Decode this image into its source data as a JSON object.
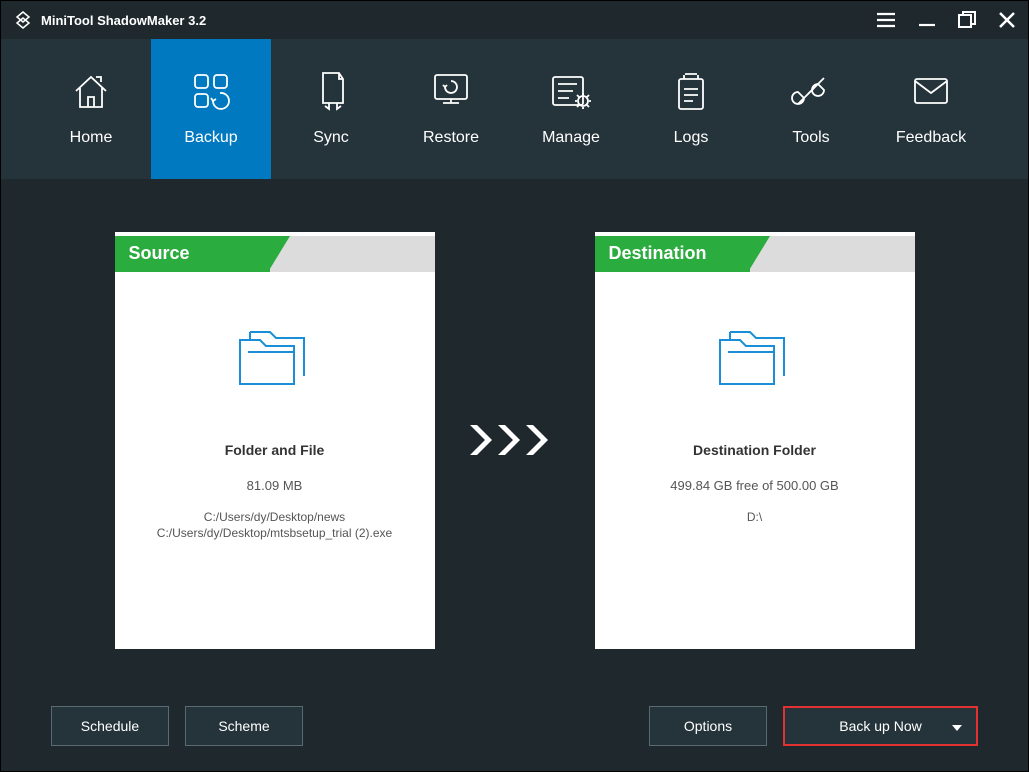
{
  "titlebar": {
    "title": "MiniTool ShadowMaker 3.2"
  },
  "nav": {
    "items": [
      {
        "label": "Home"
      },
      {
        "label": "Backup"
      },
      {
        "label": "Sync"
      },
      {
        "label": "Restore"
      },
      {
        "label": "Manage"
      },
      {
        "label": "Logs"
      },
      {
        "label": "Tools"
      },
      {
        "label": "Feedback"
      }
    ]
  },
  "source": {
    "header": "Source",
    "title": "Folder and File",
    "size": "81.09 MB",
    "path1": "C:/Users/dy/Desktop/news",
    "path2": "C:/Users/dy/Desktop/mtsbsetup_trial (2).exe"
  },
  "destination": {
    "header": "Destination",
    "title": "Destination Folder",
    "space": "499.84 GB free of 500.00 GB",
    "drive": "D:\\"
  },
  "footer": {
    "schedule": "Schedule",
    "scheme": "Scheme",
    "options": "Options",
    "backupnow": "Back up Now"
  }
}
